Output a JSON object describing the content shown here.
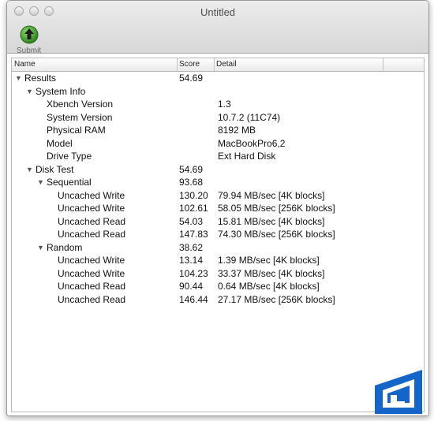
{
  "window": {
    "title": "Untitled"
  },
  "toolbar": {
    "submit_label": "Submit"
  },
  "table": {
    "headers": {
      "name": "Name",
      "score": "Score",
      "detail": "Detail"
    },
    "rows": [
      {
        "name": "Results",
        "score": "54.69",
        "detail": "",
        "expanded": true
      },
      {
        "name": "System Info",
        "score": "",
        "detail": "",
        "expanded": true
      },
      {
        "name": "Xbench Version",
        "score": "",
        "detail": "1.3"
      },
      {
        "name": "System Version",
        "score": "",
        "detail": "10.7.2 (11C74)"
      },
      {
        "name": "Physical RAM",
        "score": "",
        "detail": "8192 MB"
      },
      {
        "name": "Model",
        "score": "",
        "detail": "MacBookPro6,2"
      },
      {
        "name": "Drive Type",
        "score": "",
        "detail": "Ext Hard Disk"
      },
      {
        "name": "Disk Test",
        "score": "54.69",
        "detail": "",
        "expanded": true
      },
      {
        "name": "Sequential",
        "score": "93.68",
        "detail": "",
        "expanded": true
      },
      {
        "name": "Uncached Write",
        "score": "130.20",
        "detail": "79.94 MB/sec [4K blocks]"
      },
      {
        "name": "Uncached Write",
        "score": "102.61",
        "detail": "58.05 MB/sec [256K blocks]"
      },
      {
        "name": "Uncached Read",
        "score": "54.03",
        "detail": "15.81 MB/sec [4K blocks]"
      },
      {
        "name": "Uncached Read",
        "score": "147.83",
        "detail": "74.30 MB/sec [256K blocks]"
      },
      {
        "name": "Random",
        "score": "38.62",
        "detail": "",
        "expanded": true
      },
      {
        "name": "Uncached Write",
        "score": "13.14",
        "detail": "1.39 MB/sec [4K blocks]"
      },
      {
        "name": "Uncached Write",
        "score": "104.23",
        "detail": "33.37 MB/sec [4K blocks]"
      },
      {
        "name": "Uncached Read",
        "score": "90.44",
        "detail": "0.64 MB/sec [4K blocks]"
      },
      {
        "name": "Uncached Read",
        "score": "146.44",
        "detail": "27.17 MB/sec [256K blocks]"
      }
    ]
  },
  "icons": {
    "submit": "green-up-arrow-icon",
    "disclosure": "disclosure-triangle-icon",
    "logo": "legit-reviews-logo"
  },
  "colors": {
    "submit_green": "#3f9a2c",
    "logo_blue": "#1565c8"
  }
}
